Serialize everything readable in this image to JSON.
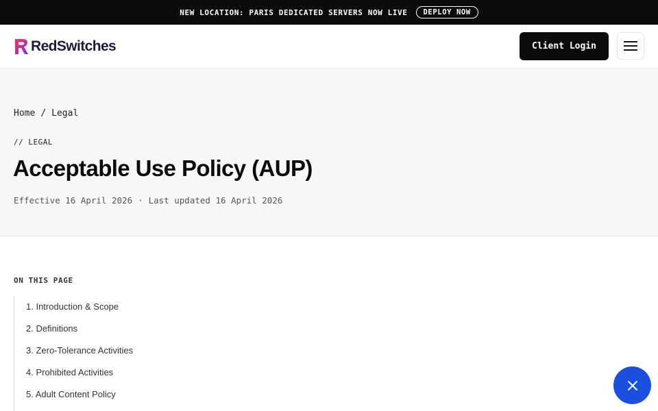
{
  "announcement": {
    "text": "NEW LOCATION: PARIS DEDICATED SERVERS NOW LIVE",
    "cta_label": "DEPLOY NOW"
  },
  "header": {
    "logo_text": "RedSwitches",
    "login_label": "Client Login",
    "menu_icon": "hamburger-menu-icon"
  },
  "breadcrumb": {
    "items": [
      "Home",
      "Legal"
    ],
    "separator": "/"
  },
  "hero": {
    "eyebrow": "// LEGAL",
    "title": "Acceptable Use Policy (AUP)",
    "effective": "Effective 16 April 2026",
    "separator": "·",
    "last_updated": "Last updated 16 April 2026"
  },
  "toc": {
    "heading": "ON THIS PAGE",
    "items": [
      "1. Introduction & Scope",
      "2. Definitions",
      "3. Zero-Tolerance Activities",
      "4. Prohibited Activities",
      "5. Adult Content Policy"
    ]
  },
  "fab": {
    "icon": "close-icon"
  },
  "colors": {
    "announcement_bg": "#0b0b0b",
    "button_dark": "#0b0b0b",
    "hero_bg": "#f7f7f7",
    "fab_blue": "#1a4fe0",
    "logo_gradient_start": "#ff2d55",
    "logo_gradient_end": "#7b2ff7"
  }
}
